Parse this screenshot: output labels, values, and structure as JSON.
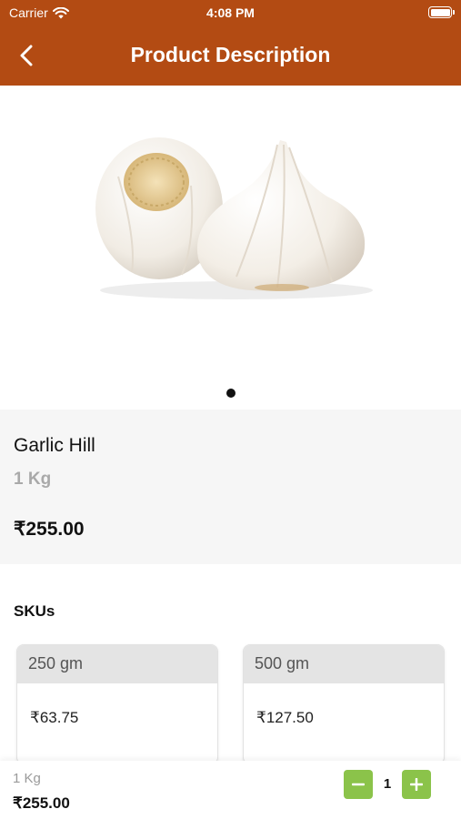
{
  "status_bar": {
    "carrier": "Carrier",
    "time": "4:08 PM"
  },
  "header": {
    "title": "Product Description",
    "back_icon": "chevron-left-icon"
  },
  "carousel": {
    "current": 1,
    "total": 1
  },
  "product": {
    "name": "Garlic Hill",
    "weight": "1 Kg",
    "price": "₹255.00"
  },
  "skus": {
    "heading": "SKUs",
    "items": [
      {
        "label": "250 gm",
        "price": "₹63.75"
      },
      {
        "label": "500 gm",
        "price": "₹127.50"
      }
    ]
  },
  "cart_bar": {
    "weight": "1 Kg",
    "price": "₹255.00",
    "quantity": "1"
  },
  "colors": {
    "header": "#b34b13",
    "stepper": "#8bc34a",
    "info_bg": "#f6f6f6"
  }
}
